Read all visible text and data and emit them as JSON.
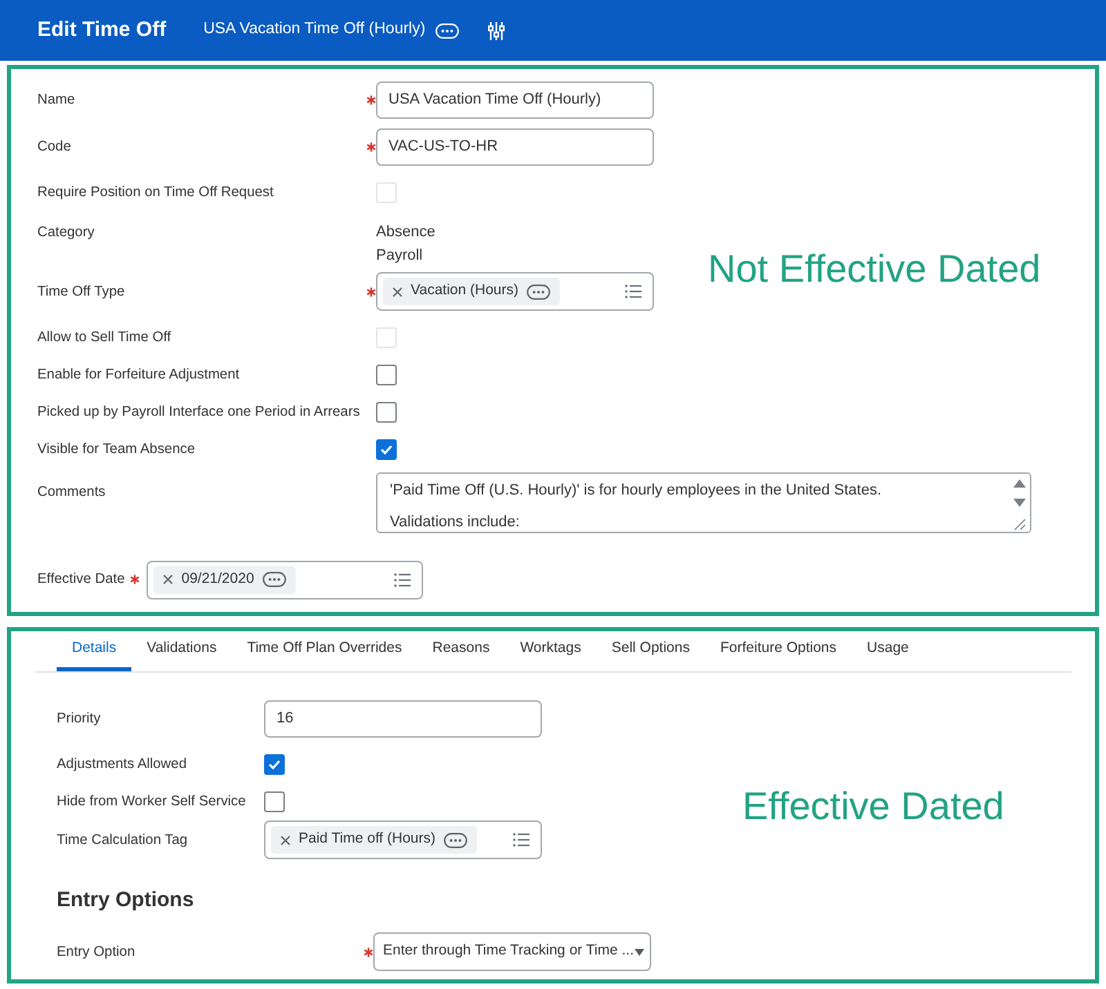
{
  "header": {
    "title": "Edit Time Off",
    "subtitle": "USA Vacation Time Off (Hourly)"
  },
  "not_effective_dated": {
    "annotation": "Not Effective Dated",
    "fields": [
      {
        "kind": "text",
        "label": "Name",
        "required": true,
        "value": "USA Vacation Time Off (Hourly)"
      },
      {
        "kind": "text",
        "label": "Code",
        "required": true,
        "value": "VAC-US-TO-HR"
      },
      {
        "kind": "checkbox",
        "label": "Require Position on Time Off Request",
        "checked": false,
        "disabled": true
      },
      {
        "kind": "values",
        "label": "Category",
        "values": [
          "Absence",
          "Payroll"
        ]
      },
      {
        "kind": "prompt",
        "label": "Time Off Type",
        "required": true,
        "tags": [
          "Vacation (Hours)"
        ]
      },
      {
        "kind": "checkbox",
        "label": "Allow to Sell Time Off",
        "checked": false,
        "disabled": true
      },
      {
        "kind": "checkbox",
        "label": "Enable for Forfeiture Adjustment",
        "checked": false,
        "disabled": false
      },
      {
        "kind": "checkbox",
        "label": "Picked up by Payroll Interface one Period in Arrears",
        "checked": false,
        "disabled": false
      },
      {
        "kind": "checkbox",
        "label": "Visible for Team Absence",
        "checked": true,
        "disabled": false
      },
      {
        "kind": "textarea",
        "label": "Comments",
        "lines": [
          "'Paid Time Off (U.S. Hourly)' is for hourly employees in the United States.",
          "Validations include:"
        ]
      }
    ],
    "effective_date": {
      "label": "Effective Date",
      "required": true,
      "tags": [
        "09/21/2020"
      ]
    }
  },
  "effective_dated": {
    "annotation": "Effective Dated",
    "tabs": [
      {
        "label": "Details",
        "selected": true
      },
      {
        "label": "Validations",
        "selected": false
      },
      {
        "label": "Time Off Plan Overrides",
        "selected": false
      },
      {
        "label": "Reasons",
        "selected": false
      },
      {
        "label": "Worktags",
        "selected": false
      },
      {
        "label": "Sell Options",
        "selected": false
      },
      {
        "label": "Forfeiture Options",
        "selected": false
      },
      {
        "label": "Usage",
        "selected": false
      }
    ],
    "fields": [
      {
        "kind": "text",
        "label": "Priority",
        "value": "16"
      },
      {
        "kind": "checkbox",
        "label": "Adjustments Allowed",
        "checked": true,
        "disabled": false
      },
      {
        "kind": "checkbox",
        "label": "Hide from Worker Self Service",
        "checked": false,
        "disabled": false
      },
      {
        "kind": "prompt",
        "label": "Time Calculation Tag",
        "tags": [
          "Paid Time off (Hours)"
        ]
      }
    ],
    "entry_options": {
      "heading": "Entry Options",
      "fields": [
        {
          "kind": "select",
          "label": "Entry Option",
          "required": true,
          "value": "Enter through Time Tracking or Time ..."
        }
      ]
    }
  }
}
